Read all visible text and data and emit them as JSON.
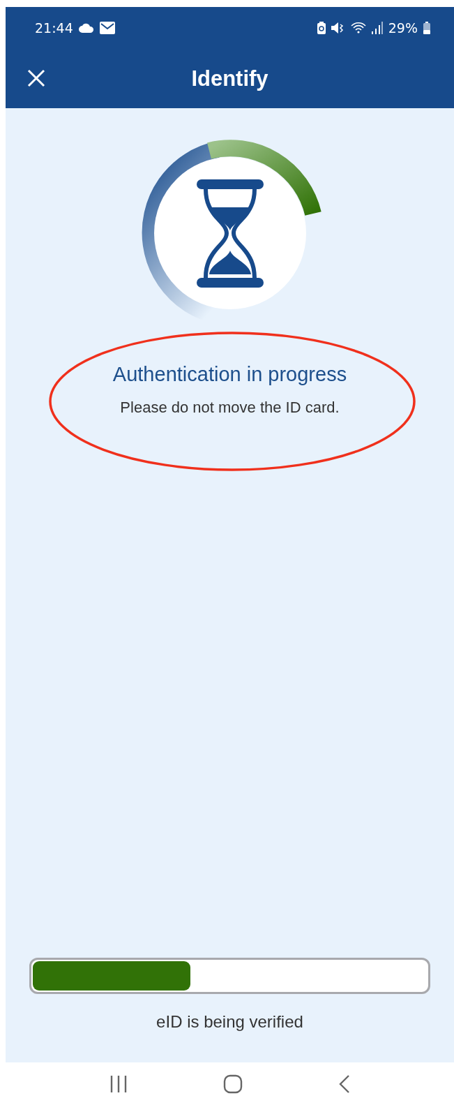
{
  "status_bar": {
    "time": "21:44",
    "battery": "29%"
  },
  "header": {
    "title": "Identify"
  },
  "status": {
    "title": "Authentication in progress",
    "message": "Please do not move the ID card."
  },
  "progress": {
    "level": 0.4,
    "label": "eID is being verified"
  }
}
